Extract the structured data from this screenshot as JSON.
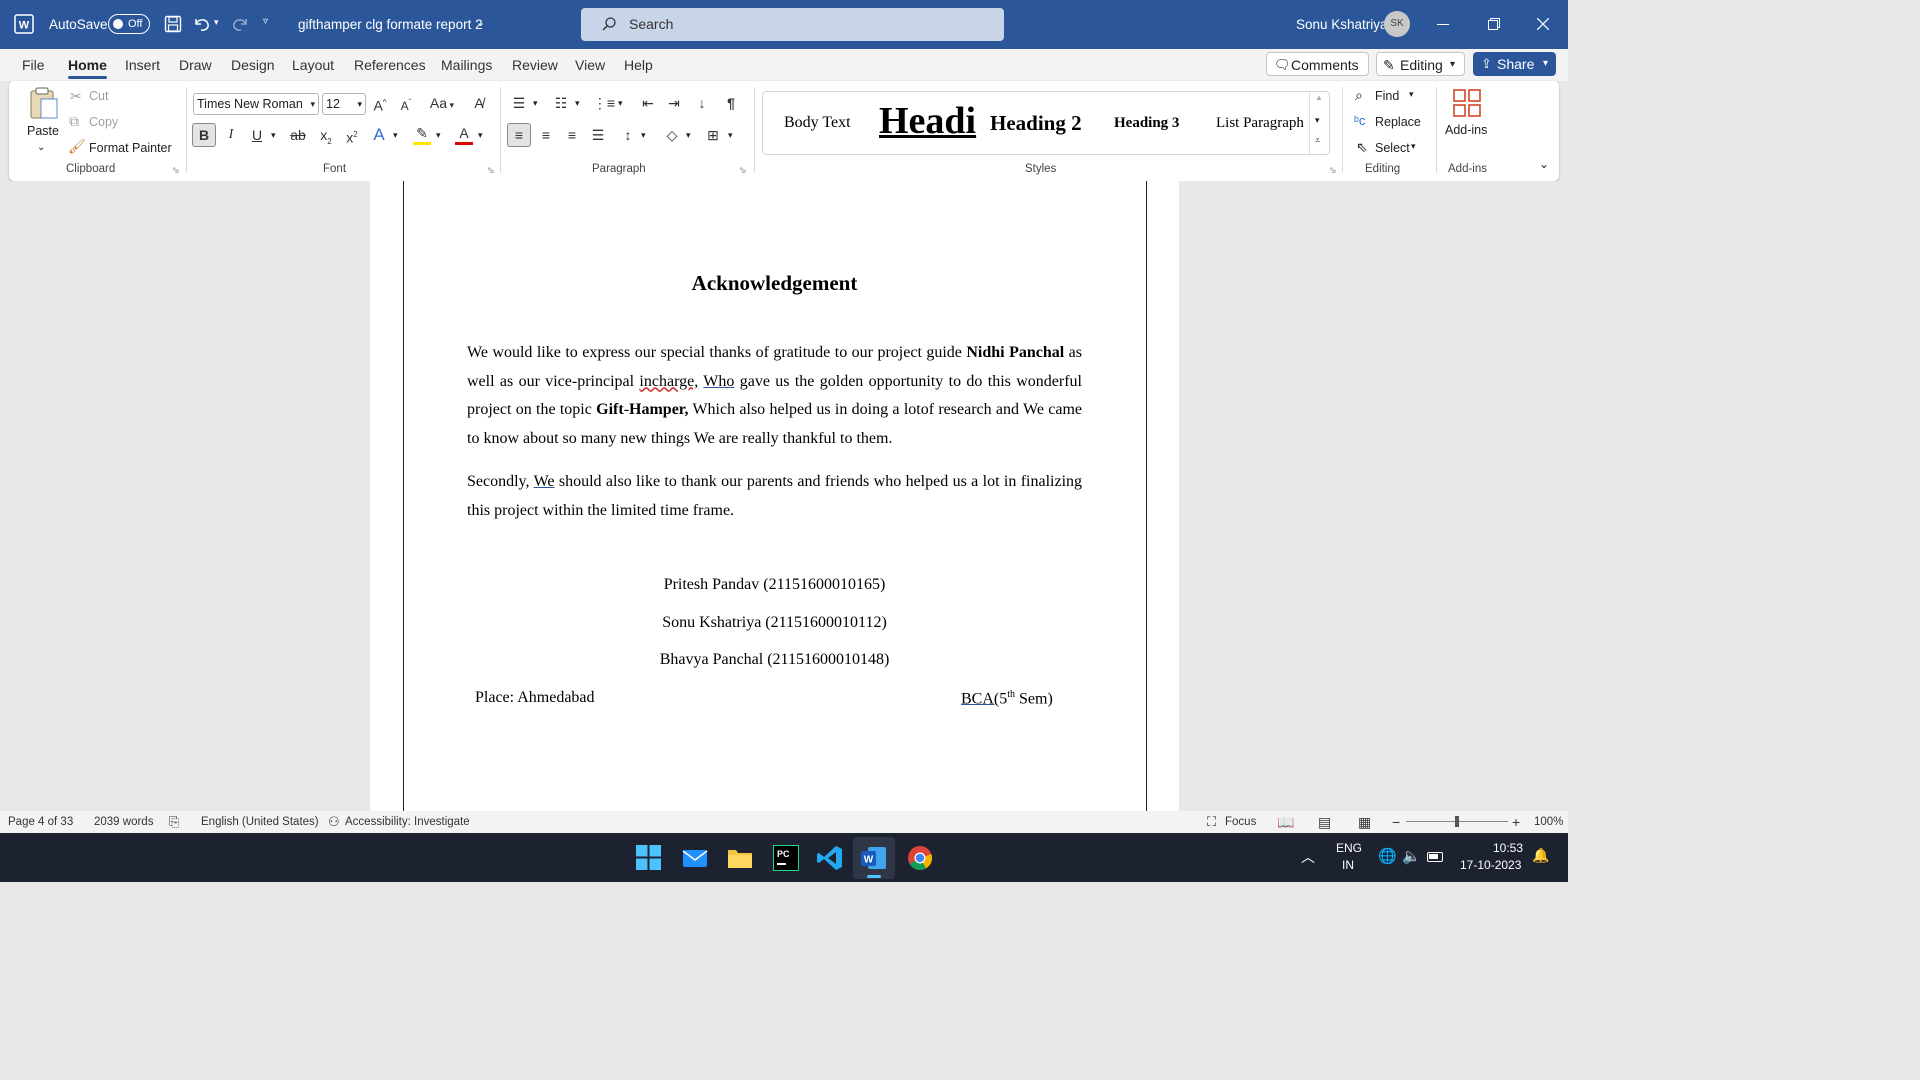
{
  "titlebar": {
    "autosave_label": "AutoSave",
    "autosave_state": "Off",
    "document_title": "gifthamper clg formate report 2",
    "search_placeholder": "Search",
    "user_name": "Sonu Kshatriya",
    "user_initials": "SK",
    "accent_color": "#2b579a"
  },
  "menu": {
    "tabs": [
      "File",
      "Home",
      "Insert",
      "Draw",
      "Design",
      "Layout",
      "References",
      "Mailings",
      "Review",
      "View",
      "Help"
    ],
    "active_tab": "Home",
    "comments_label": "Comments",
    "editing_label": "Editing",
    "share_label": "Share"
  },
  "ribbon": {
    "clipboard": {
      "paste": "Paste",
      "cut": "Cut",
      "copy": "Copy",
      "format_painter": "Format Painter",
      "group_label": "Clipboard"
    },
    "font": {
      "font_name": "Times New Roman",
      "font_size": "12",
      "group_label": "Font",
      "change_case": "Aa"
    },
    "paragraph": {
      "group_label": "Paragraph"
    },
    "styles": {
      "items": [
        "Body Text",
        "Headi",
        "Heading 2",
        "Heading 3",
        "List Paragraph"
      ],
      "group_label": "Styles"
    },
    "editing": {
      "find": "Find",
      "replace": "Replace",
      "select": "Select",
      "group_label": "Editing"
    },
    "addins": {
      "label": "Add-ins",
      "group_label": "Add-ins"
    }
  },
  "document": {
    "heading": "Acknowledgement",
    "p1_a": "We would like to express our special thanks of gratitude to our project guide ",
    "p1_b": "Nidhi Panchal",
    "p1_c": " as well as our vice-principal ",
    "p1_d": "incharge,",
    "p1_e": " ",
    "p1_f": "Who",
    "p1_g": " gave us the golden opportunity to do this wonderful project on the topic ",
    "p1_h": "Gift",
    "p1_i": "-",
    "p1_j": "Hamper,",
    "p1_k": " Which also helped us in doing a lotof research and We came to know about so many new things We are really thankful to them.",
    "p2_a": "Secondly, ",
    "p2_b": "We",
    "p2_c": " should also like to thank our parents and friends who helped us a lot in finalizing this project within the limited time frame.",
    "names": [
      "Pritesh Pandav (21151600010165)",
      "Sonu Kshatriya (21151600010112)",
      "Bhavya Panchal (21151600010148)"
    ],
    "place": "Place: Ahmedabad",
    "class_a": "BCA(",
    "class_b": "5",
    "class_c": "th",
    "class_d": " Sem)"
  },
  "status": {
    "page": "Page 4 of 33",
    "words": "2039 words",
    "language": "English (United States)",
    "accessibility": "Accessibility: Investigate",
    "focus": "Focus",
    "zoom": "100%"
  },
  "taskbar": {
    "lang_top": "ENG",
    "lang_bottom": "IN",
    "time": "10:53",
    "date": "17-10-2023"
  }
}
